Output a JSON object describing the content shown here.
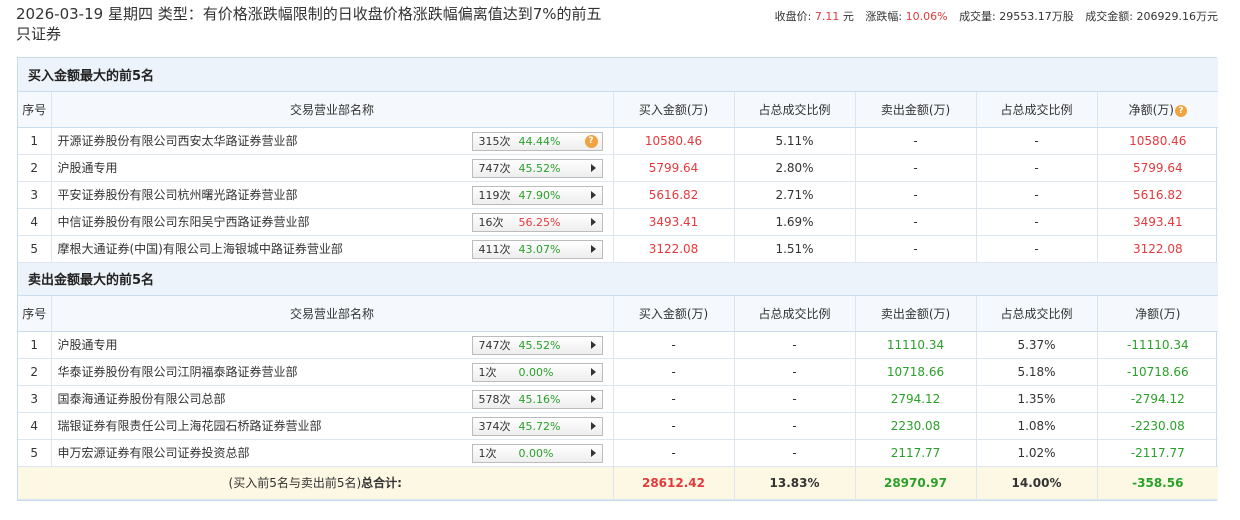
{
  "header": {
    "title": "2026-03-19 星期四 类型：有价格涨跌幅限制的日收盘价格涨跌幅偏离值达到7%的前五只证券",
    "close_label": "收盘价:",
    "close_value": "7.11",
    "close_unit": "元",
    "change_label": "涨跌幅:",
    "change_value": "10.06%",
    "volume_label": "成交量:",
    "volume_value": "29553.17万股",
    "amount_label": "成交金额:",
    "amount_value": "206929.16万元"
  },
  "buy_section": {
    "title": "买入金额最大的前5名",
    "columns": [
      "序号",
      "交易营业部名称",
      "买入金额(万)",
      "占总成交比例",
      "卖出金额(万)",
      "占总成交比例",
      "净额(万)"
    ],
    "rows": [
      {
        "idx": "1",
        "name": "开源证券股份有限公司西安太华路证券营业部",
        "count": "315次",
        "pct": "44.44%",
        "buy": "10580.46",
        "buy_ratio": "5.11%",
        "sell": "-",
        "sell_ratio": "-",
        "net": "10580.46"
      },
      {
        "idx": "2",
        "name": "沪股通专用",
        "count": "747次",
        "pct": "45.52%",
        "buy": "5799.64",
        "buy_ratio": "2.80%",
        "sell": "-",
        "sell_ratio": "-",
        "net": "5799.64"
      },
      {
        "idx": "3",
        "name": "平安证券股份有限公司杭州曙光路证券营业部",
        "count": "119次",
        "pct": "47.90%",
        "buy": "5616.82",
        "buy_ratio": "2.71%",
        "sell": "-",
        "sell_ratio": "-",
        "net": "5616.82"
      },
      {
        "idx": "4",
        "name": "中信证券股份有限公司东阳吴宁西路证券营业部",
        "count": "16次",
        "pct": "56.25%",
        "buy": "3493.41",
        "buy_ratio": "1.69%",
        "sell": "-",
        "sell_ratio": "-",
        "net": "3493.41"
      },
      {
        "idx": "5",
        "name": "摩根大通证券(中国)有限公司上海银城中路证券营业部",
        "count": "411次",
        "pct": "43.07%",
        "buy": "3122.08",
        "buy_ratio": "1.51%",
        "sell": "-",
        "sell_ratio": "-",
        "net": "3122.08"
      }
    ]
  },
  "sell_section": {
    "title": "卖出金额最大的前5名",
    "columns": [
      "序号",
      "交易营业部名称",
      "买入金额(万)",
      "占总成交比例",
      "卖出金额(万)",
      "占总成交比例",
      "净额(万)"
    ],
    "rows": [
      {
        "idx": "1",
        "name": "沪股通专用",
        "count": "747次",
        "pct": "45.52%",
        "buy": "-",
        "buy_ratio": "-",
        "sell": "11110.34",
        "sell_ratio": "5.37%",
        "net": "-11110.34"
      },
      {
        "idx": "2",
        "name": "华泰证券股份有限公司江阴福泰路证券营业部",
        "count": "1次",
        "pct": "0.00%",
        "buy": "-",
        "buy_ratio": "-",
        "sell": "10718.66",
        "sell_ratio": "5.18%",
        "net": "-10718.66"
      },
      {
        "idx": "3",
        "name": "国泰海通证券股份有限公司总部",
        "count": "578次",
        "pct": "45.16%",
        "buy": "-",
        "buy_ratio": "-",
        "sell": "2794.12",
        "sell_ratio": "1.35%",
        "net": "-2794.12"
      },
      {
        "idx": "4",
        "name": "瑞银证券有限责任公司上海花园石桥路证券营业部",
        "count": "374次",
        "pct": "45.72%",
        "buy": "-",
        "buy_ratio": "-",
        "sell": "2230.08",
        "sell_ratio": "1.08%",
        "net": "-2230.08"
      },
      {
        "idx": "5",
        "name": "申万宏源证券有限公司证券投资总部",
        "count": "1次",
        "pct": "0.00%",
        "buy": "-",
        "buy_ratio": "-",
        "sell": "2117.77",
        "sell_ratio": "1.02%",
        "net": "-2117.77"
      }
    ]
  },
  "total": {
    "label_prefix": "(买入前5名与卖出前5名)",
    "label_bold": "总合计:",
    "buy": "28612.42",
    "buy_ratio": "13.83%",
    "sell": "28970.97",
    "sell_ratio": "14.00%",
    "net": "-358.56"
  },
  "colors": {
    "up": "#e4393c",
    "down": "#2aa02a",
    "total_bg": "#fdf8e4",
    "section_bg": "#edf3fa"
  },
  "icons": {
    "help": "question-icon",
    "expand": "triangle-right-icon"
  }
}
